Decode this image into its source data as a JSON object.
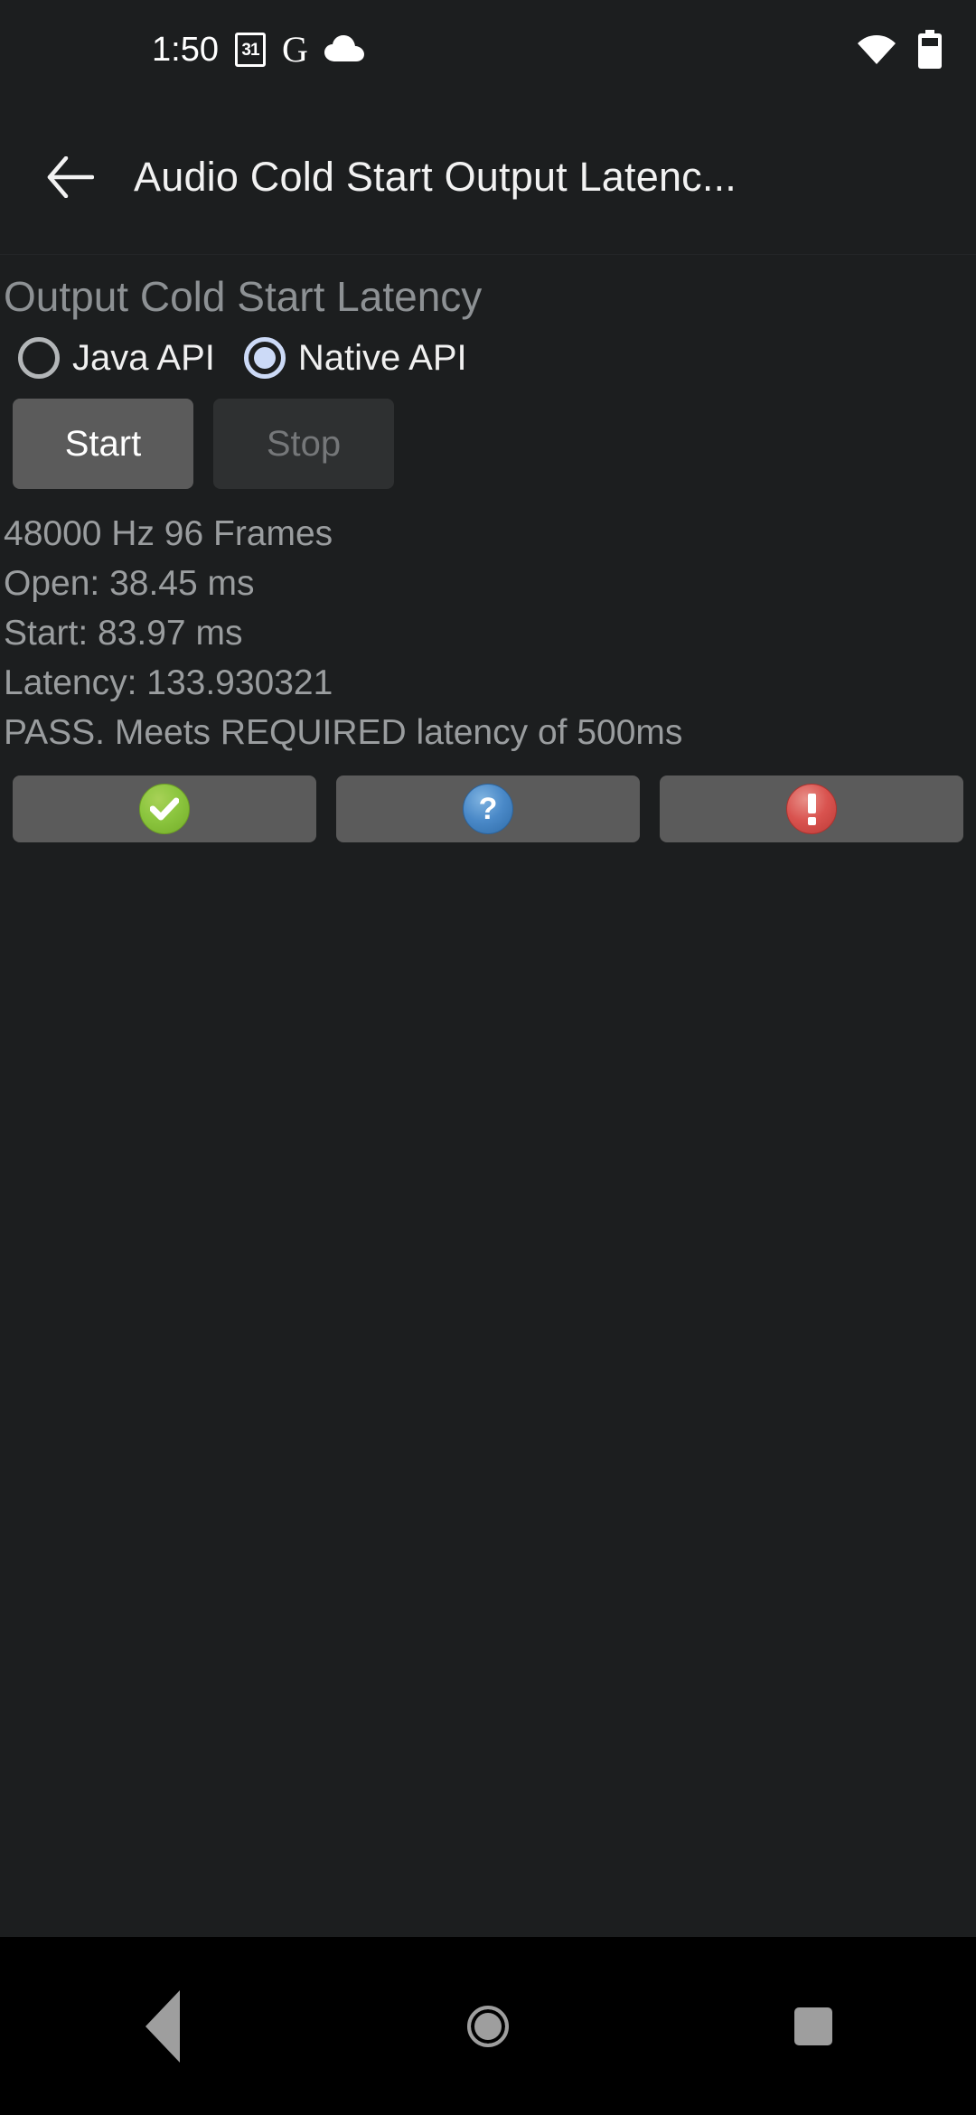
{
  "status_bar": {
    "clock": "1:50",
    "calendar_day": "31",
    "google_glyph": "G",
    "icons": [
      "calendar-icon",
      "google-icon",
      "cloud-icon",
      "wifi-icon",
      "battery-icon"
    ]
  },
  "app_bar": {
    "back_label": "back-arrow",
    "title": "Audio Cold Start Output Latenc..."
  },
  "main": {
    "section_title": "Output Cold Start Latency",
    "api_options": [
      {
        "label": "Java API",
        "selected": false
      },
      {
        "label": "Native API",
        "selected": true
      }
    ],
    "buttons": [
      {
        "label": "Start",
        "enabled": true
      },
      {
        "label": "Stop",
        "enabled": false
      }
    ],
    "results": [
      "48000 Hz 96 Frames",
      "Open: 38.45 ms",
      "Start: 83.97 ms",
      "Latency: 133.930321",
      "PASS. Meets REQUIRED latency of 500ms"
    ],
    "result_buttons": [
      {
        "icon": "check-circle-icon",
        "glyph": "✔",
        "color": "#8cc63f"
      },
      {
        "icon": "question-circle-icon",
        "glyph": "?",
        "color": "#4a89c8"
      },
      {
        "icon": "warning-circle-icon",
        "glyph": "!",
        "color": "#d9534f"
      }
    ]
  },
  "nav_bar": {
    "items": [
      "back-nav-icon",
      "home-nav-icon",
      "recents-nav-icon"
    ]
  },
  "colors": {
    "background": "#1c1e1f",
    "accent_radio": "#ccdaf7",
    "button_enabled": "#5b5b5b",
    "button_disabled": "#2e3031",
    "text_secondary": "#9a9d9f",
    "nav_background": "#000000"
  }
}
